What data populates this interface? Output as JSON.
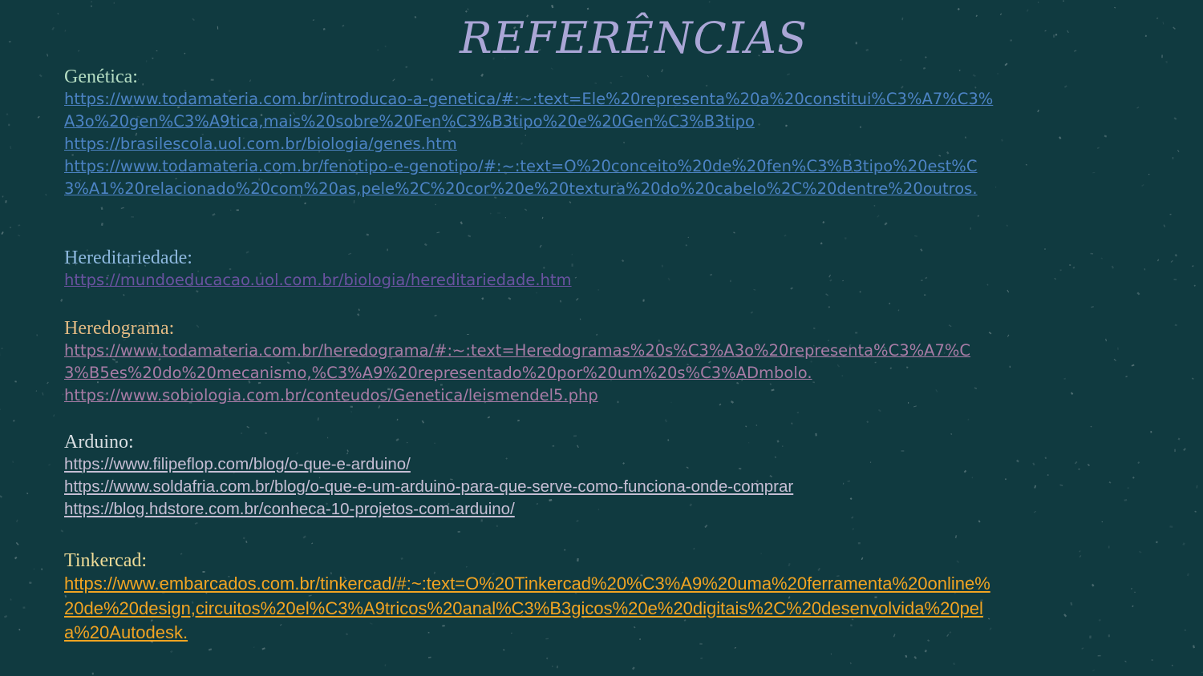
{
  "title": "REFERÊNCIAS",
  "colors": {
    "background": "#103a40",
    "title": "#aaa6d6",
    "genetica_heading": "#b4dcc2",
    "genetica_link": "#4c83c4",
    "hereditariedade_heading": "#8db8de",
    "hereditariedade_link": "#6a52a0",
    "heredograma_heading": "#e2ba83",
    "heredograma_link": "#a87ca6",
    "arduino_heading": "#d8dee2",
    "arduino_link": "#c6bed4",
    "tinkercad_heading": "#f0dc98",
    "tinkercad_link": "#f2a422"
  },
  "sections": [
    {
      "heading": "Genética:",
      "links": [
        "https://www.todamateria.com.br/introducao-a-genetica/#:~:text=Ele%20representa%20a%20constitui%C3%A7%C3%A3o%20gen%C3%A9tica,mais%20sobre%20Fen%C3%B3tipo%20e%20Gen%C3%B3tipo",
        "https://brasilescola.uol.com.br/biologia/genes.htm",
        "https://www.todamateria.com.br/fenotipo-e-genotipo/#:~:text=O%20conceito%20de%20fen%C3%B3tipo%20est%C3%A1%20relacionado%20com%20as,pele%2C%20cor%20e%20textura%20do%20cabelo%2C%20dentre%20outros."
      ]
    },
    {
      "heading": "Hereditariedade:",
      "links": [
        "https://mundoeducacao.uol.com.br/biologia/hereditariedade.htm"
      ]
    },
    {
      "heading": "Heredograma:",
      "links": [
        "https://www.todamateria.com.br/heredograma/#:~:text=Heredogramas%20s%C3%A3o%20representa%C3%A7%C3%B5es%20do%20mecanismo,%C3%A9%20representado%20por%20um%20s%C3%ADmbolo.",
        "https://www.sobiologia.com.br/conteudos/Genetica/leismendel5.php"
      ]
    },
    {
      "heading": "Arduino:",
      "links": [
        "https://www.filipeflop.com/blog/o-que-e-arduino/",
        "https://www.soldafria.com.br/blog/o-que-e-um-arduino-para-que-serve-como-funciona-onde-comprar",
        "https://blog.hdstore.com.br/conheca-10-projetos-com-arduino/"
      ]
    },
    {
      "heading": "Tinkercad:",
      "links": [
        "https://www.embarcados.com.br/tinkercad/#:~:text=O%20Tinkercad%20%C3%A9%20uma%20ferramenta%20online%20de%20design,circuitos%20el%C3%A9tricos%20anal%C3%B3gicos%20e%20digitais%2C%20desenvolvida%20pela%20Autodesk."
      ]
    }
  ]
}
